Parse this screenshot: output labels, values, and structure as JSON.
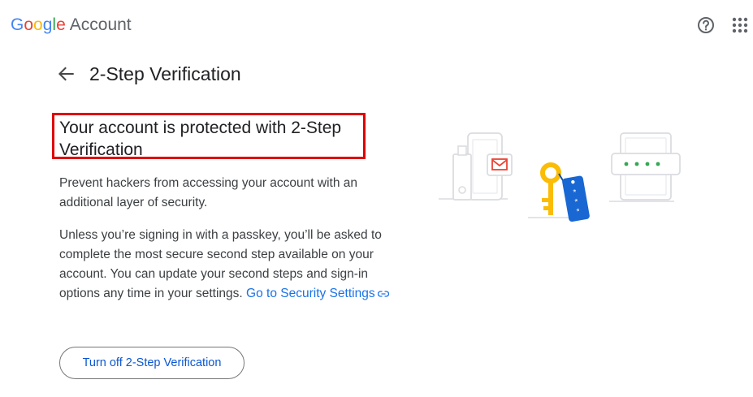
{
  "header": {
    "logo": {
      "letters": [
        "G",
        "o",
        "o",
        "g",
        "l",
        "e"
      ],
      "product": "Account"
    },
    "help_icon": "help-circle-icon",
    "apps_icon": "apps-grid-icon"
  },
  "page": {
    "back_icon": "arrow-back-icon",
    "title": "2-Step Verification"
  },
  "content": {
    "heading": "Your account is protected with 2-Step Verification",
    "paragraph1": "Prevent hackers from accessing your account with an additional layer of security.",
    "paragraph2": "Unless you’re signing in with a passkey, you’ll be asked to complete the most secure second step available on your account. You can update your second steps and sign-in options any time in your settings.",
    "security_link": "Go to Security Settings",
    "link_icon": "link-icon",
    "turn_off_button": "Turn off 2-Step Verification"
  },
  "illustration": {
    "password_dots": "● ● ● ●",
    "key_tag_text": "* * *"
  },
  "colors": {
    "accent": "#1a73e8",
    "button_text": "#0b57d0",
    "highlight": "#e00000",
    "key_yellow": "#fbbc05",
    "tag_blue": "#1967d2",
    "dot_green": "#34a853"
  }
}
